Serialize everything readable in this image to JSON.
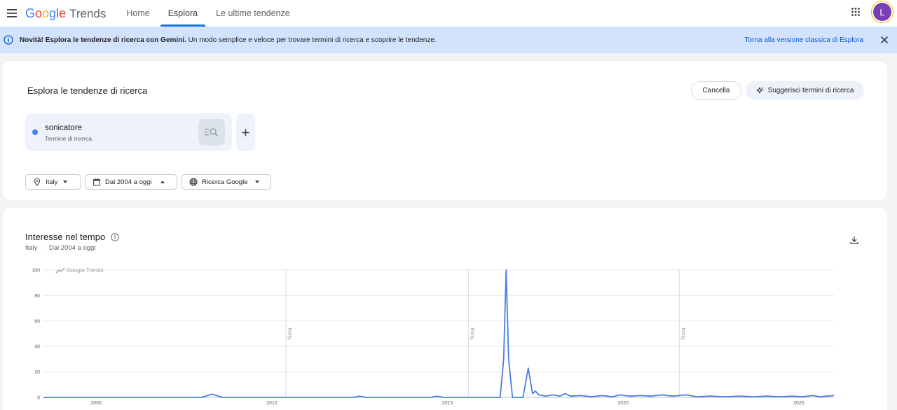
{
  "header": {
    "logo_google": "Google",
    "logo_trends": "Trends",
    "tabs": [
      {
        "label": "Home"
      },
      {
        "label": "Esplora"
      },
      {
        "label": "Le ultime tendenze"
      }
    ],
    "avatar_letter": "L"
  },
  "banner": {
    "bold_text": "Novità! Esplora le tendenze di ricerca con Gemini.",
    "text": " Un modo semplice e veloce per trovare termini di ricerca e scoprire le tendenze.",
    "link": "Torna alla versione classica di Esplora"
  },
  "explore": {
    "title": "Esplora le tendenze di ricerca",
    "cancel_label": "Cancella",
    "suggest_label": "Suggerisci termini di ricerca",
    "term": {
      "name": "sonicatore",
      "type": "Termine di ricerca",
      "color": "#4285f4"
    },
    "filters": {
      "location": "Italy",
      "time": "Dal 2004 a oggi",
      "property": "Ricerca Google"
    }
  },
  "interest": {
    "title": "Interesse nel tempo",
    "subtitle_location": "Italy",
    "subtitle_separator": "·",
    "subtitle_time": "Dal 2004 a oggi",
    "watermark": "Google Trends"
  },
  "chart_data": {
    "type": "line",
    "title": "Interesse nel tempo",
    "xlabel": "",
    "ylabel": "",
    "xlim": [
      2004,
      2026.5
    ],
    "ylim": [
      0,
      100
    ],
    "x_ticks": [
      "2005",
      "2010",
      "2015",
      "2020",
      "2025"
    ],
    "y_ticks": [
      "0",
      "20",
      "40",
      "60",
      "80",
      "100"
    ],
    "grid": true,
    "annotations": [
      {
        "label": "Nota",
        "x": 2010.9
      },
      {
        "label": "Nota",
        "x": 2016.1
      },
      {
        "label": "Nota",
        "x": 2022.1
      }
    ],
    "series": [
      {
        "color": "#4a7fe0",
        "points": [
          [
            2004.0,
            0
          ],
          [
            2008.5,
            0
          ],
          [
            2008.8,
            2.5
          ],
          [
            2009.1,
            0
          ],
          [
            2012.8,
            0
          ],
          [
            2013.0,
            1
          ],
          [
            2013.2,
            0
          ],
          [
            2015.0,
            0
          ],
          [
            2015.2,
            1
          ],
          [
            2015.4,
            0
          ],
          [
            2017.0,
            0
          ],
          [
            2017.1,
            30
          ],
          [
            2017.17,
            100
          ],
          [
            2017.24,
            30
          ],
          [
            2017.35,
            0
          ],
          [
            2017.65,
            0
          ],
          [
            2017.8,
            23
          ],
          [
            2017.92,
            3
          ],
          [
            2018.0,
            5
          ],
          [
            2018.1,
            2
          ],
          [
            2018.3,
            1
          ],
          [
            2018.5,
            2
          ],
          [
            2018.7,
            1
          ],
          [
            2018.85,
            3
          ],
          [
            2019.0,
            1
          ],
          [
            2019.3,
            1.5
          ],
          [
            2019.6,
            0.5
          ],
          [
            2019.9,
            1.5
          ],
          [
            2020.2,
            0.5
          ],
          [
            2020.4,
            2
          ],
          [
            2020.7,
            1
          ],
          [
            2021.0,
            1.5
          ],
          [
            2021.3,
            1
          ],
          [
            2021.6,
            2
          ],
          [
            2021.9,
            1
          ],
          [
            2022.3,
            2
          ],
          [
            2022.6,
            0.5
          ],
          [
            2023.0,
            1
          ],
          [
            2023.4,
            0.5
          ],
          [
            2023.8,
            1
          ],
          [
            2024.2,
            0.5
          ],
          [
            2024.6,
            1
          ],
          [
            2025.0,
            0.5
          ],
          [
            2025.3,
            1
          ],
          [
            2025.6,
            0.5
          ],
          [
            2025.9,
            1.5
          ],
          [
            2026.1,
            0.5
          ],
          [
            2026.3,
            1
          ],
          [
            2026.5,
            1.5
          ]
        ]
      }
    ]
  }
}
